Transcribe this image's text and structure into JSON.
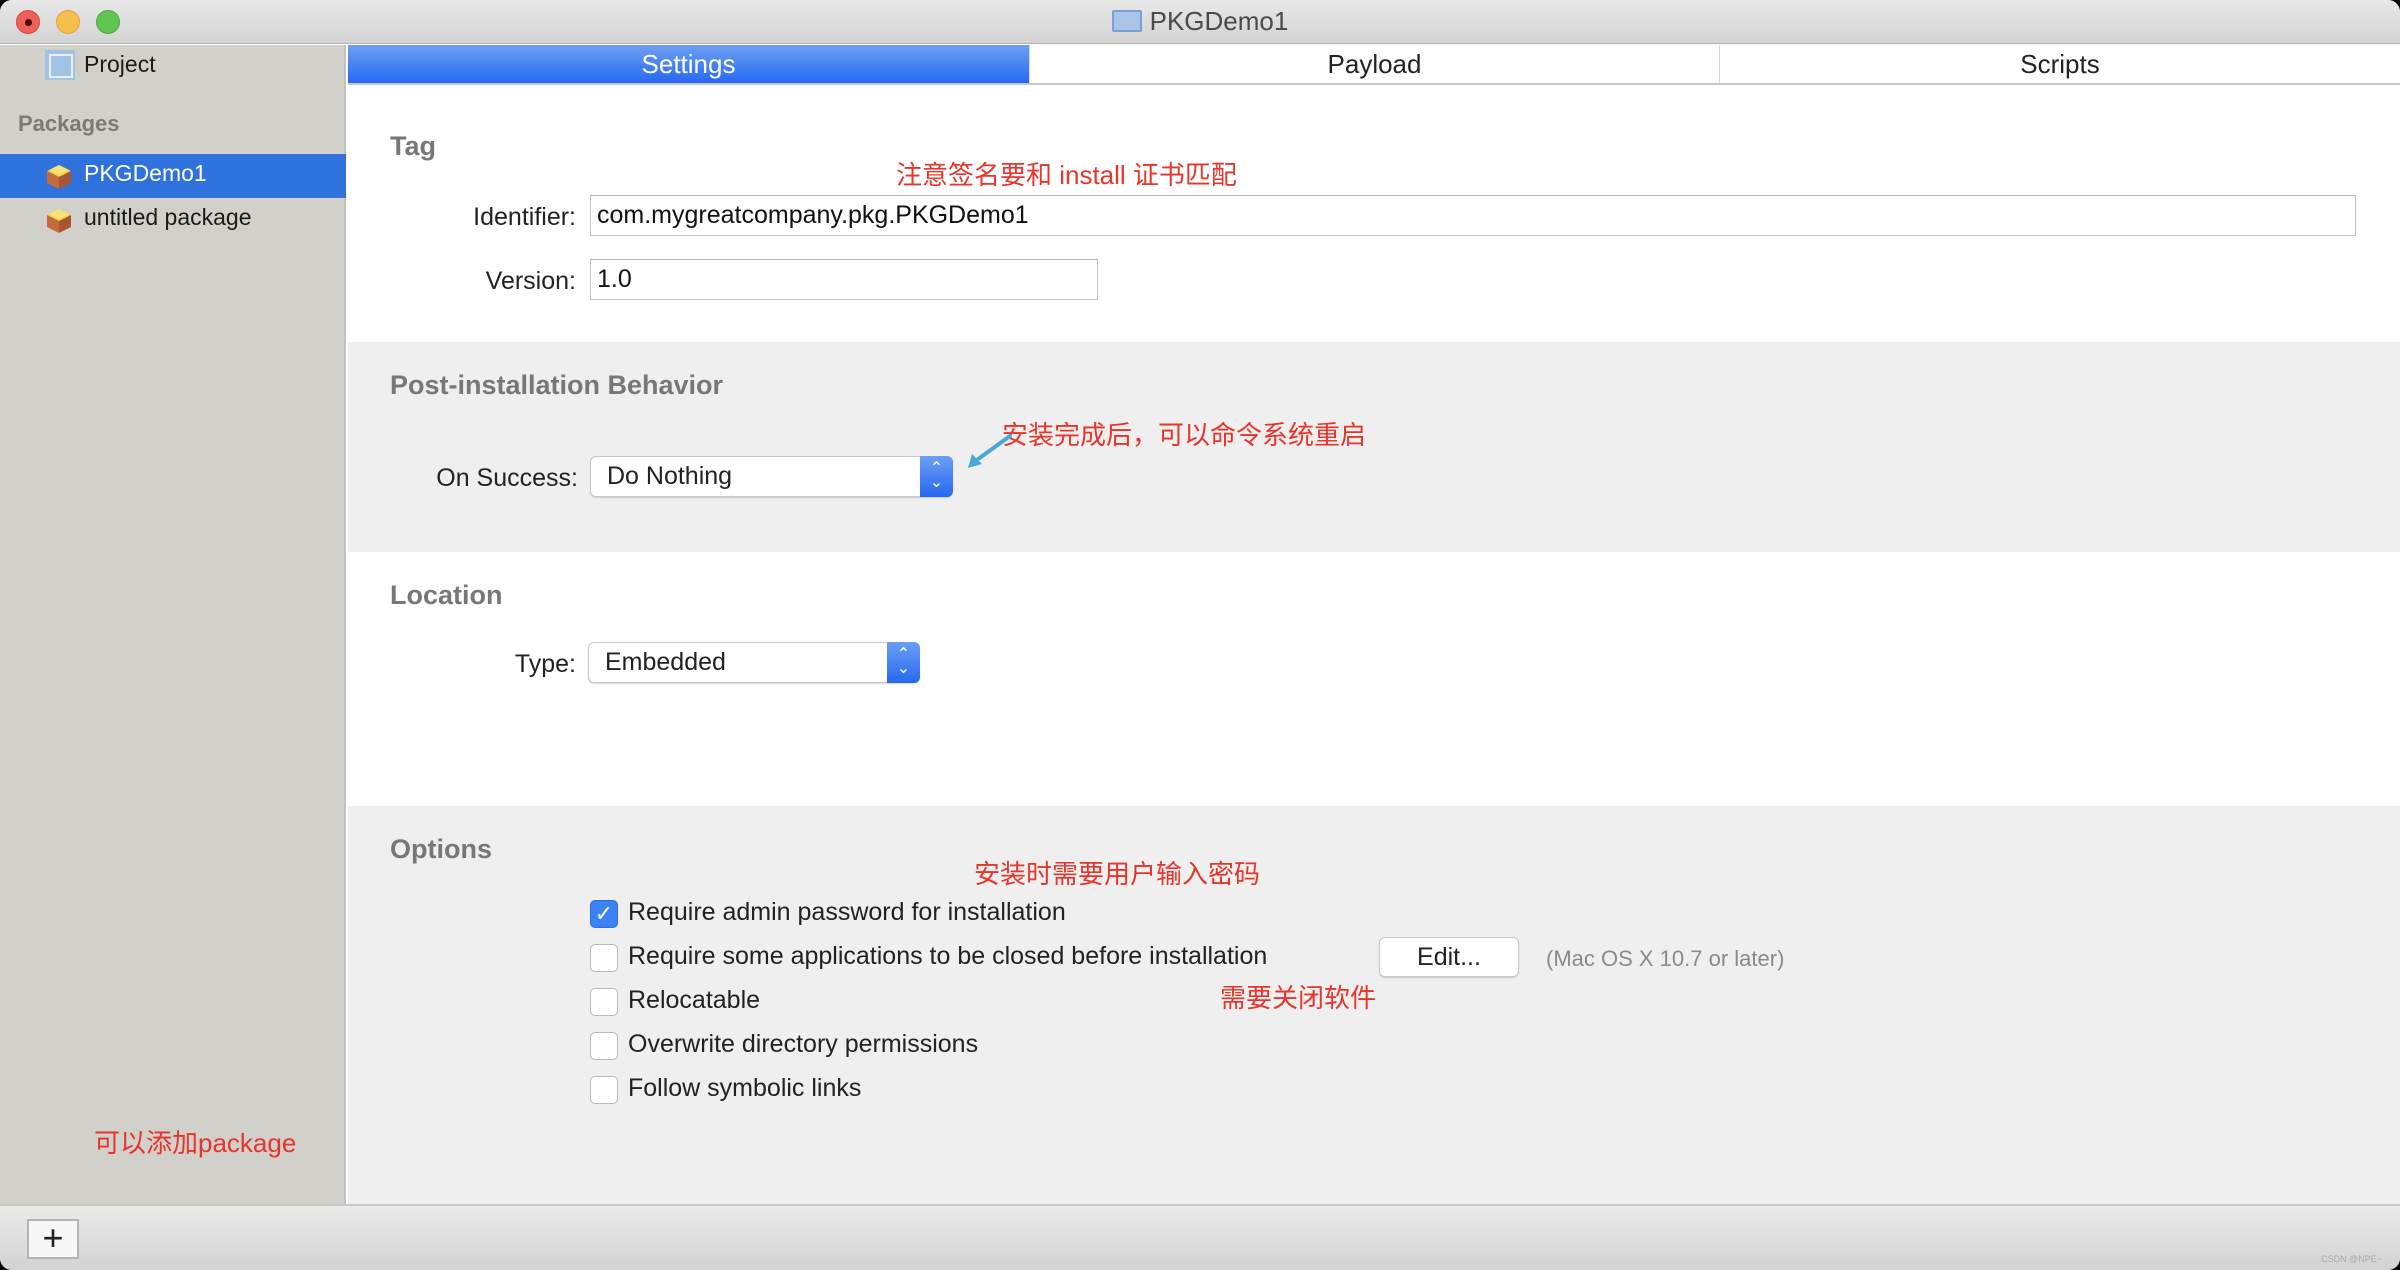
{
  "window": {
    "title": "PKGDemo1",
    "title_icon": "project-document-icon"
  },
  "sidebar": {
    "project_label": "Project",
    "packages_header": "Packages",
    "packages": [
      {
        "label": "PKGDemo1",
        "selected": true
      },
      {
        "label": "untitled package",
        "selected": false
      }
    ]
  },
  "tabs": [
    {
      "label": "Settings",
      "active": true
    },
    {
      "label": "Payload",
      "active": false
    },
    {
      "label": "Scripts",
      "active": false
    }
  ],
  "tag": {
    "title": "Tag",
    "identifier_label": "Identifier:",
    "identifier_value": "com.mygreatcompany.pkg.PKGDemo1",
    "version_label": "Version:",
    "version_value": "1.0"
  },
  "post_install": {
    "title": "Post-installation Behavior",
    "on_success_label": "On Success:",
    "on_success_value": "Do Nothing"
  },
  "location": {
    "title": "Location",
    "type_label": "Type:",
    "type_value": "Embedded"
  },
  "options": {
    "title": "Options",
    "items": [
      {
        "label": "Require admin password for installation",
        "checked": true
      },
      {
        "label": "Require some applications to be closed before installation",
        "checked": false
      },
      {
        "label": "Relocatable",
        "checked": false
      },
      {
        "label": "Overwrite directory permissions",
        "checked": false
      },
      {
        "label": "Follow symbolic links",
        "checked": false
      }
    ],
    "edit_button": "Edit...",
    "edit_hint": "(Mac OS X 10.7 or later)"
  },
  "annotations": {
    "signature": "注意签名要和 install 证书匹配",
    "restart": "安装完成后，可以命令系统重启",
    "password": "安装时需要用户输入密码",
    "close_apps": "需要关闭软件",
    "add_package": "可以添加package"
  },
  "bottombar": {
    "add_button": "+",
    "watermark": "CSDN @NPE~"
  },
  "colors": {
    "accent": "#2668f2",
    "selection": "#2f72db",
    "annotation": "#e8342b",
    "arrow": "#4aa8d8"
  }
}
